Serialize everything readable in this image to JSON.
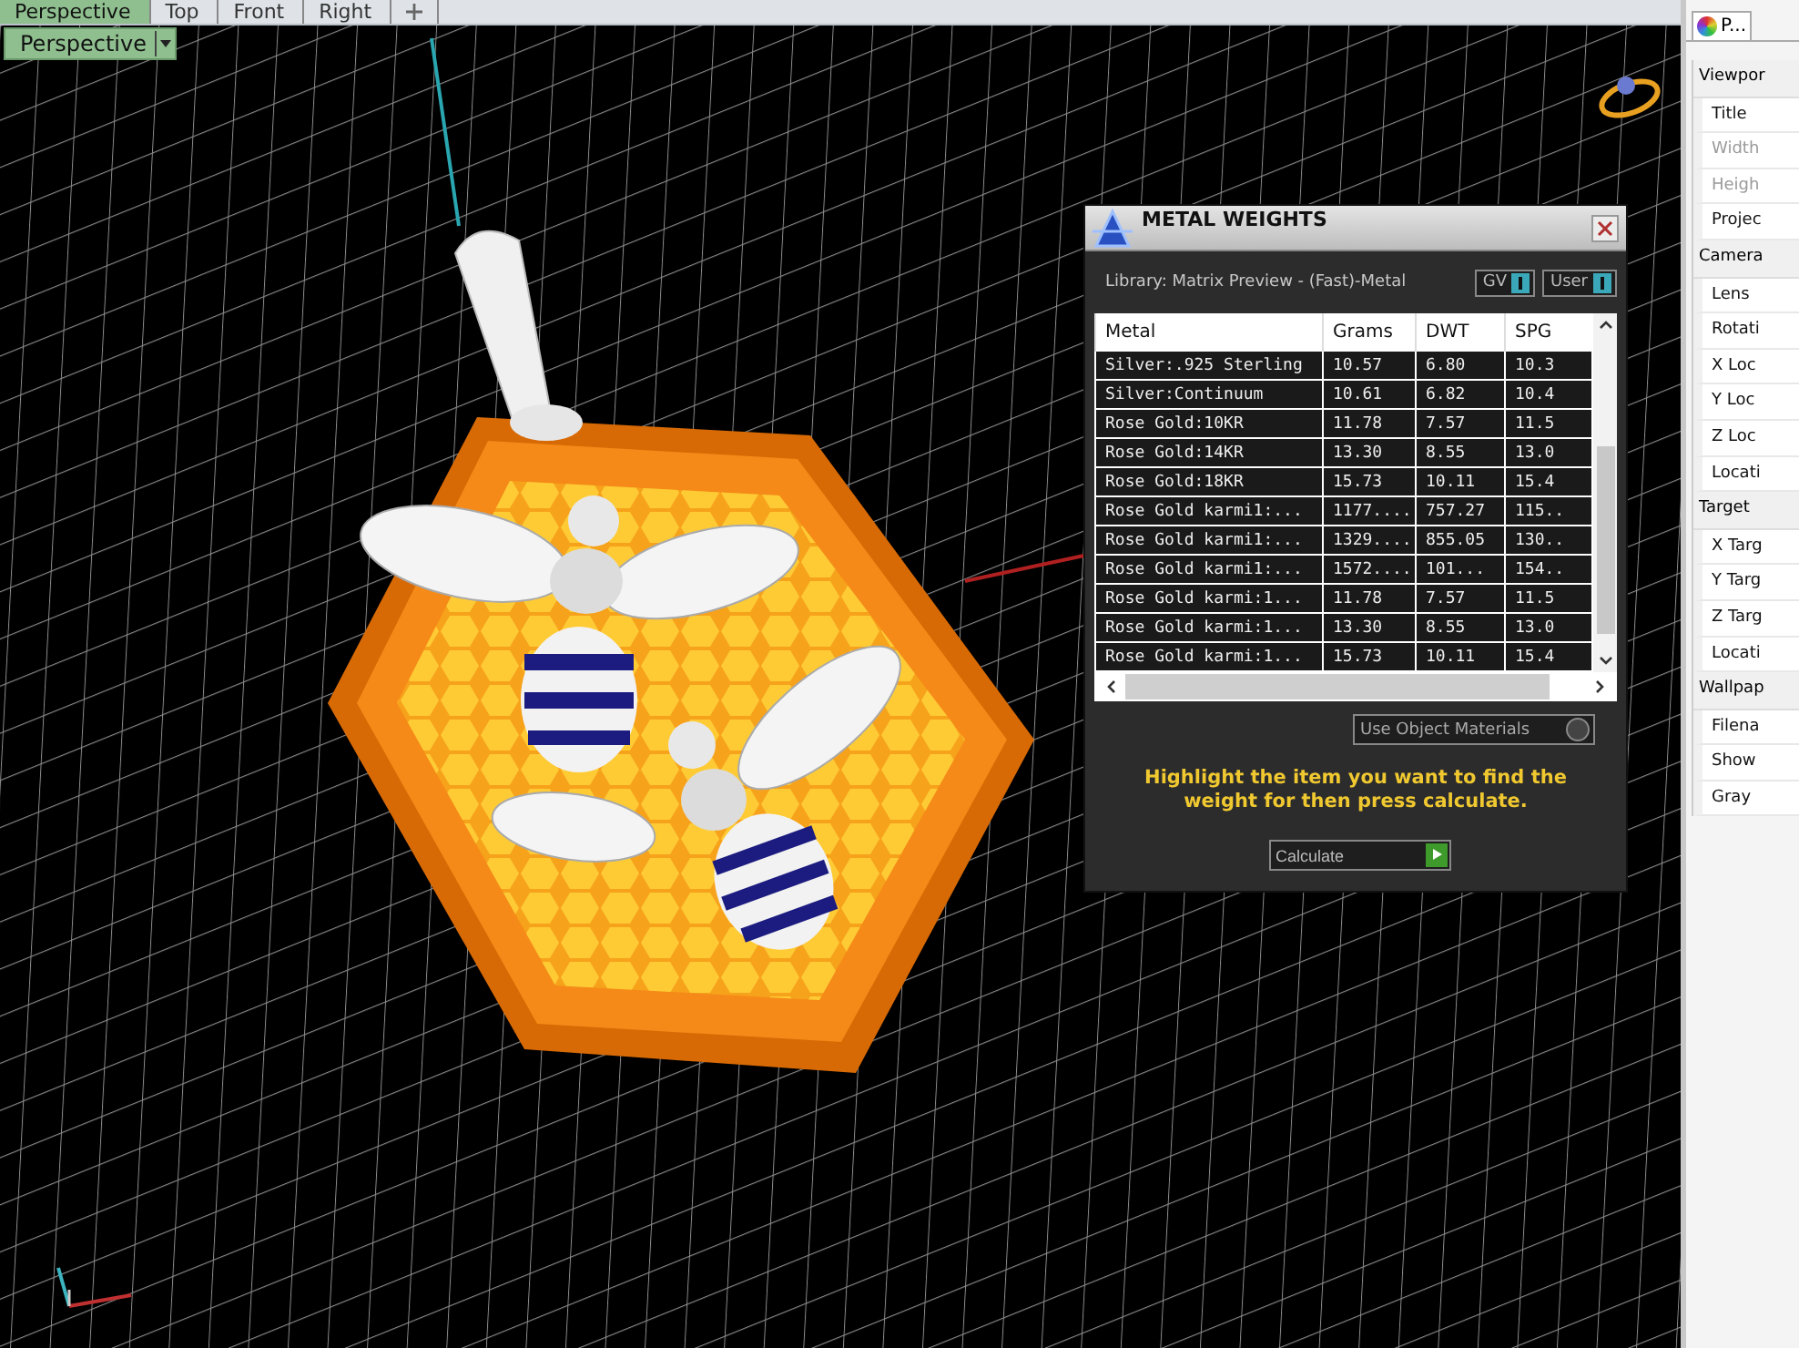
{
  "viewport_tabs": [
    {
      "label": "Perspective",
      "selected": true
    },
    {
      "label": "Top",
      "selected": false
    },
    {
      "label": "Front",
      "selected": false
    },
    {
      "label": "Right",
      "selected": false
    }
  ],
  "viewport": {
    "title": "Perspective"
  },
  "metal_weights": {
    "title": "METAL WEIGHTS",
    "library": "Library: Matrix Preview - (Fast)-Metal",
    "toggles": [
      {
        "label": "GV",
        "on": true
      },
      {
        "label": "User",
        "on": true
      }
    ],
    "table": {
      "columns": [
        "Metal",
        "Grams",
        "DWT",
        "SPG"
      ],
      "rows": [
        [
          "Silver:.925 Sterling",
          "10.57",
          "6.80",
          "10.3"
        ],
        [
          "Silver:Continuum",
          "10.61",
          "6.82",
          "10.4"
        ],
        [
          "Rose Gold:10KR",
          "11.78",
          "7.57",
          "11.5"
        ],
        [
          "Rose Gold:14KR",
          "13.30",
          "8.55",
          "13.0"
        ],
        [
          "Rose Gold:18KR",
          "15.73",
          "10.11",
          "15.4"
        ],
        [
          "Rose Gold karmi1:...",
          "1177....",
          "757.27",
          "115.."
        ],
        [
          "Rose Gold karmi1:...",
          "1329....",
          "855.05",
          "130.."
        ],
        [
          "Rose Gold karmi1:...",
          "1572....",
          "101...",
          "154.."
        ],
        [
          "Rose Gold karmi:1...",
          "11.78",
          "7.57",
          "11.5"
        ],
        [
          "Rose Gold karmi:1...",
          "13.30",
          "8.55",
          "13.0"
        ],
        [
          "Rose Gold karmi:1...",
          "15.73",
          "10.11",
          "15.4"
        ]
      ]
    },
    "use_object_materials": {
      "label": "Use Object Materials",
      "on": false
    },
    "hint": "Highlight the item you want to find the weight for then press calculate.",
    "button": "Calculate"
  },
  "properties": {
    "tab": "P...",
    "sections": [
      {
        "label": "Viewpor",
        "items": [
          {
            "label": "Title",
            "disabled": false
          },
          {
            "label": "Width",
            "disabled": true
          },
          {
            "label": "Heigh",
            "disabled": true
          },
          {
            "label": "Projec",
            "disabled": false
          }
        ]
      },
      {
        "label": "Camera",
        "items": [
          {
            "label": "Lens",
            "disabled": false
          },
          {
            "label": "Rotati",
            "disabled": false
          },
          {
            "label": "X Loc",
            "disabled": false
          },
          {
            "label": "Y Loc",
            "disabled": false
          },
          {
            "label": "Z Loc",
            "disabled": false
          },
          {
            "label": "Locati",
            "disabled": false
          }
        ]
      },
      {
        "label": "Target",
        "items": [
          {
            "label": "X Targ",
            "disabled": false
          },
          {
            "label": "Y Targ",
            "disabled": false
          },
          {
            "label": "Z Targ",
            "disabled": false
          },
          {
            "label": "Locati",
            "disabled": false
          }
        ]
      },
      {
        "label": "Wallpap",
        "items": [
          {
            "label": "Filena",
            "disabled": false
          },
          {
            "label": "Show",
            "disabled": false
          },
          {
            "label": "Gray",
            "disabled": false
          }
        ]
      }
    ]
  }
}
